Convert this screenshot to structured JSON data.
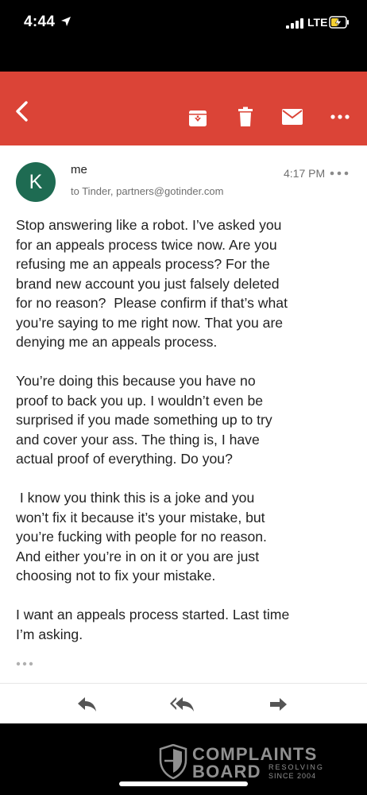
{
  "status_bar": {
    "time": "4:44",
    "network": "LTE"
  },
  "toolbar": {
    "icons": [
      "back-arrow-icon",
      "archive-icon",
      "trash-icon",
      "mail-icon",
      "more-horiz-icon"
    ],
    "color": "#db4437"
  },
  "message": {
    "avatar_letter": "K",
    "avatar_color": "#1e6b52",
    "sender": "me",
    "recipients": "to Tinder, partners@gotinder.com",
    "time": "4:17 PM",
    "paragraphs": [
      "Stop answering like a robot. I’ve asked you\nfor an appeals process twice now. Are you\nrefusing me an appeals process? For the\nbrand new account you just falsely deleted\nfor no reason?  Please confirm if that’s what\nyou’re saying to me right now. That you are\ndenying me an appeals process.",
      "You’re doing this because you have no\nproof to back you up. I wouldn’t even be\nsurprised if you made something up to try\nand cover your ass. The thing is, I have\nactual proof of everything. Do you?",
      " I know you think this is a joke and you\nwon’t fix it because it’s your mistake, but\nyou’re fucking with people for no reason.\nAnd either you’re in on it or you are just\nchoosing not to fix your mistake.",
      "I want an appeals process started. Last time\nI’m asking."
    ]
  },
  "actions": {
    "icons": [
      "reply-icon",
      "reply-all-icon",
      "forward-icon"
    ]
  },
  "watermark": {
    "line1": "COMPLAINTS",
    "line2": "BOARD",
    "tag1": "RESOLVING",
    "tag2": "SINCE 2004"
  }
}
